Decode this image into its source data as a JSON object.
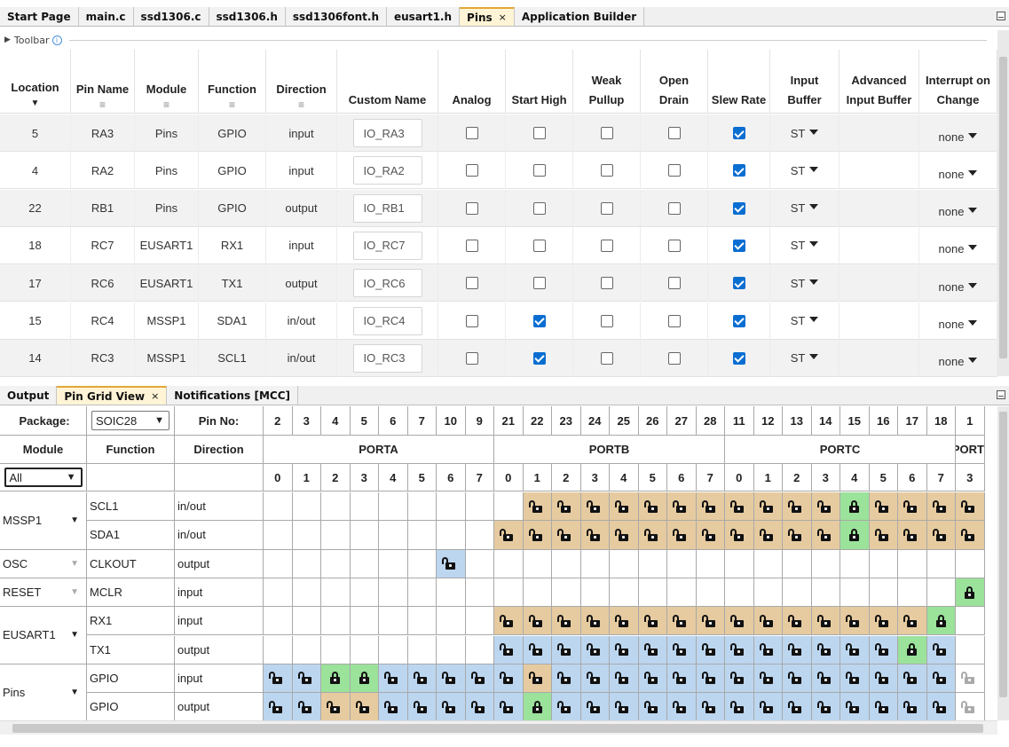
{
  "editor_tabs": [
    {
      "label": "Start Page",
      "active": false
    },
    {
      "label": "main.c",
      "active": false
    },
    {
      "label": "ssd1306.c",
      "active": false
    },
    {
      "label": "ssd1306.h",
      "active": false
    },
    {
      "label": "ssd1306font.h",
      "active": false
    },
    {
      "label": "eusart1.h",
      "active": false
    },
    {
      "label": "Pins",
      "active": true,
      "closable": true
    },
    {
      "label": "Application Builder",
      "active": false
    }
  ],
  "toolbar": {
    "label": "Toolbar",
    "info_icon": "info-icon"
  },
  "pins_table": {
    "headers": {
      "location": "Location",
      "pin_name": "Pin Name",
      "module": "Module",
      "function": "Function",
      "direction": "Direction",
      "custom_name": "Custom Name",
      "analog": "Analog",
      "start_high": "Start High",
      "weak_pullup": "Weak Pullup",
      "open_drain": "Open Drain",
      "slew_rate": "Slew Rate",
      "input_buffer": "Input Buffer",
      "advanced_input_buffer": "Advanced Input Buffer",
      "interrupt_on_change": "Interrupt on Change"
    },
    "rows": [
      {
        "location": "5",
        "pin": "RA3",
        "module": "Pins",
        "function": "GPIO",
        "direction": "input",
        "custom": "IO_RA3",
        "analog": false,
        "start_high": false,
        "weak_pullup": false,
        "open_drain": false,
        "slew": true,
        "buffer": "ST",
        "ioc": "none"
      },
      {
        "location": "4",
        "pin": "RA2",
        "module": "Pins",
        "function": "GPIO",
        "direction": "input",
        "custom": "IO_RA2",
        "analog": false,
        "start_high": false,
        "weak_pullup": false,
        "open_drain": false,
        "slew": true,
        "buffer": "ST",
        "ioc": "none"
      },
      {
        "location": "22",
        "pin": "RB1",
        "module": "Pins",
        "function": "GPIO",
        "direction": "output",
        "custom": "IO_RB1",
        "analog": false,
        "start_high": false,
        "weak_pullup": false,
        "open_drain": false,
        "slew": true,
        "buffer": "ST",
        "ioc": "none"
      },
      {
        "location": "18",
        "pin": "RC7",
        "module": "EUSART1",
        "function": "RX1",
        "direction": "input",
        "custom": "IO_RC7",
        "analog": false,
        "start_high": false,
        "weak_pullup": false,
        "open_drain": false,
        "slew": true,
        "buffer": "ST",
        "ioc": "none"
      },
      {
        "location": "17",
        "pin": "RC6",
        "module": "EUSART1",
        "function": "TX1",
        "direction": "output",
        "custom": "IO_RC6",
        "analog": false,
        "start_high": false,
        "weak_pullup": false,
        "open_drain": false,
        "slew": true,
        "buffer": "ST",
        "ioc": "none"
      },
      {
        "location": "15",
        "pin": "RC4",
        "module": "MSSP1",
        "function": "SDA1",
        "direction": "in/out",
        "custom": "IO_RC4",
        "analog": false,
        "start_high": true,
        "weak_pullup": false,
        "open_drain": false,
        "slew": true,
        "buffer": "ST",
        "ioc": "none"
      },
      {
        "location": "14",
        "pin": "RC3",
        "module": "MSSP1",
        "function": "SCL1",
        "direction": "in/out",
        "custom": "IO_RC3",
        "analog": false,
        "start_high": true,
        "weak_pullup": false,
        "open_drain": false,
        "slew": true,
        "buffer": "ST",
        "ioc": "none"
      }
    ]
  },
  "bottom_tabs": [
    {
      "label": "Output",
      "active": false
    },
    {
      "label": "Pin Grid View",
      "active": true,
      "closable": true
    },
    {
      "label": "Notifications [MCC]",
      "active": false
    }
  ],
  "pin_grid": {
    "package_label": "Package:",
    "package_value": "SOIC28",
    "pin_no_label": "Pin No:",
    "module_header": "Module",
    "function_header": "Function",
    "direction_header": "Direction",
    "module_filter": "All",
    "pin_numbers": [
      "2",
      "3",
      "4",
      "5",
      "6",
      "7",
      "10",
      "9",
      "21",
      "22",
      "23",
      "24",
      "25",
      "26",
      "27",
      "28",
      "11",
      "12",
      "13",
      "14",
      "15",
      "16",
      "17",
      "18",
      "1"
    ],
    "ports": [
      {
        "name": "PORTA",
        "span": 8
      },
      {
        "name": "PORTB",
        "span": 8
      },
      {
        "name": "PORTC",
        "span": 8
      },
      {
        "name": "PORTI",
        "span": 1
      }
    ],
    "bits": [
      "0",
      "1",
      "2",
      "3",
      "4",
      "5",
      "6",
      "7",
      "0",
      "1",
      "2",
      "3",
      "4",
      "5",
      "6",
      "7",
      "0",
      "1",
      "2",
      "3",
      "4",
      "5",
      "6",
      "7",
      "3"
    ],
    "rows": [
      {
        "module": "MSSP1",
        "fn": "SCL1",
        "dir": "in/out",
        "cells": ".........tttttttttttGtttt."
      },
      {
        "module": "",
        "fn": "SDA1",
        "dir": "in/out",
        "cells": "........ttttttttttttGtttt."
      },
      {
        "module": "OSC",
        "fn": "CLKOUT",
        "dir": "output",
        "cells": "......b.................."
      },
      {
        "module": "RESET",
        "fn": "MCLR",
        "dir": "input",
        "cells": "........................G"
      },
      {
        "module": "EUSART1",
        "fn": "RX1",
        "dir": "input",
        "cells": "........tttttttttttttttG."
      },
      {
        "module": "",
        "fn": "TX1",
        "dir": "output",
        "cells": "........bbbbbbbbbbbbbbGb."
      },
      {
        "module": "Pins",
        "fn": "GPIO",
        "dir": "input",
        "cells": "bbggbbbbbtbbbbbbbbbbbbbbg"
      },
      {
        "module": "",
        "fn": "GPIO",
        "dir": "output",
        "cells": "bbttbbbbbGbbbbbbbbbbbbbbg"
      }
    ],
    "colors": {
      "tan": "#e6cba0",
      "blue": "#bcd6f0",
      "green": "#9be29b"
    }
  }
}
